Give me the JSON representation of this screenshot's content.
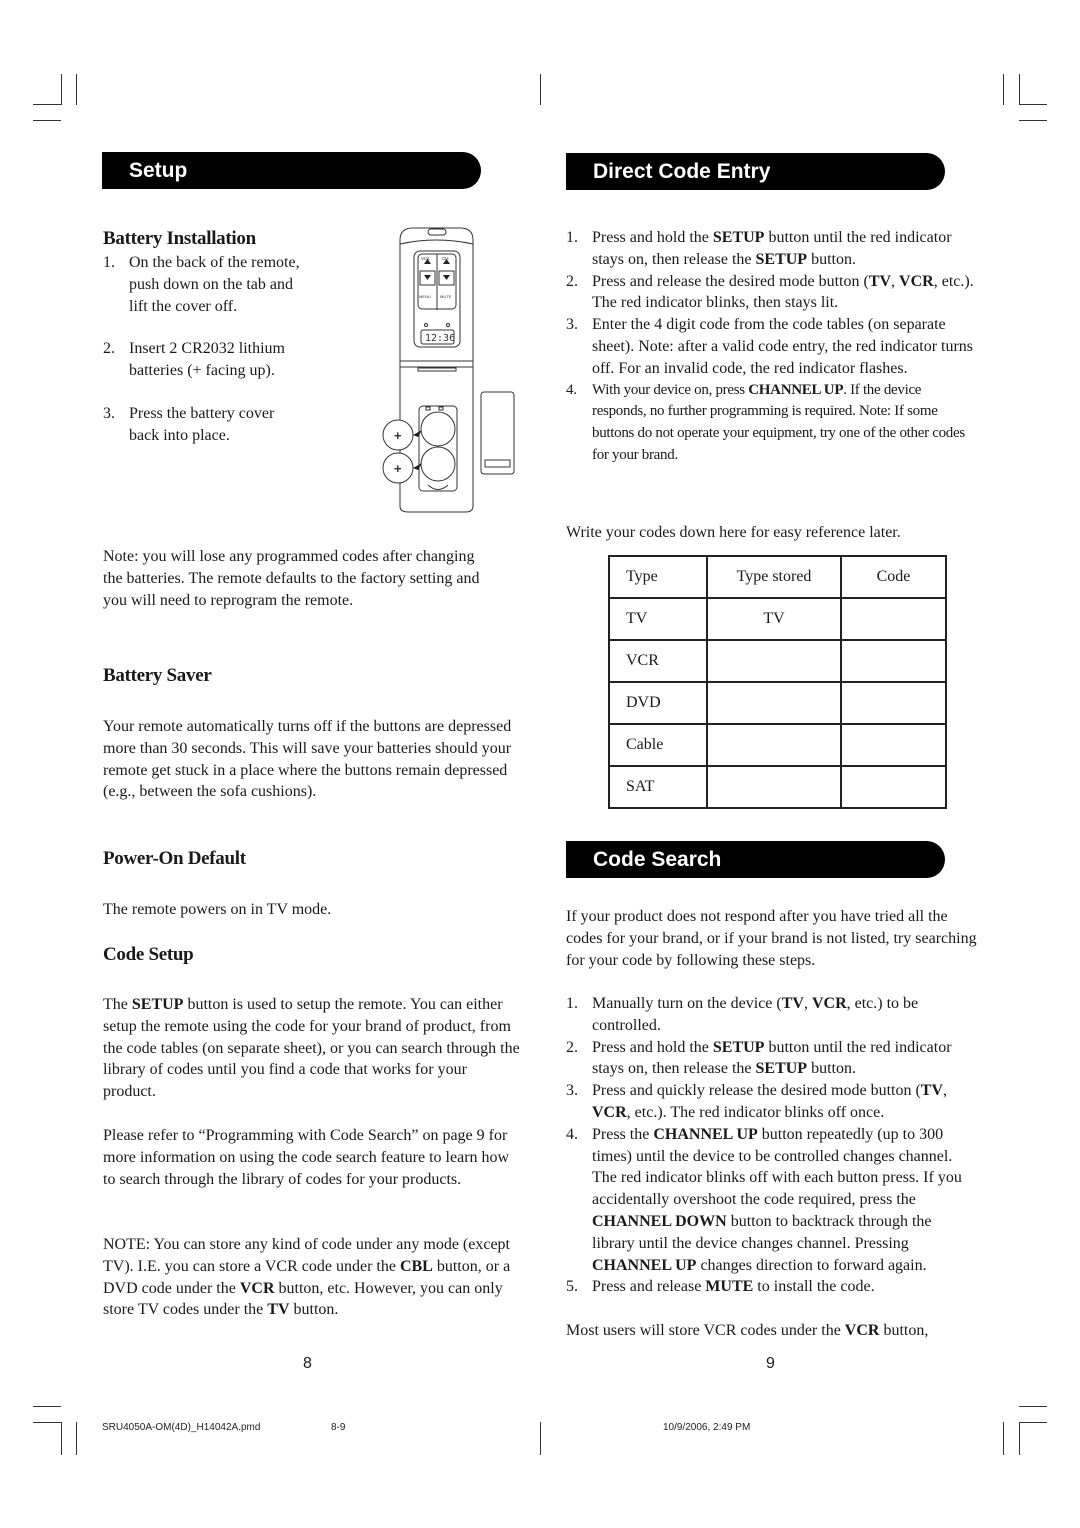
{
  "left_page": {
    "banner": "Setup",
    "battery_installation": {
      "heading": "Battery Installation",
      "steps": [
        {
          "num": "1.",
          "lines": [
            "On the back of the remote,",
            "push down on the tab and",
            "lift the cover off."
          ]
        },
        {
          "num": "2.",
          "lines": [
            "Insert 2 CR2032 lithium",
            "batteries (+ facing up)."
          ]
        },
        {
          "num": "3.",
          "lines": [
            "Press the battery cover",
            "back into place."
          ]
        }
      ],
      "illustration": {
        "remote_buttons": [
          "VOL",
          "CH",
          "MENU",
          "MUTE"
        ],
        "display": "12:36",
        "battery_sign": "+"
      },
      "note": "Note: you will lose any programmed codes after changing the batteries. The remote defaults to the factory setting and you will need to reprogram the remote."
    },
    "battery_saver": {
      "heading": "Battery Saver",
      "body": "Your remote automatically turns off if the buttons are depressed more than 30 seconds. This will save your batteries should your remote get stuck in a place where the buttons remain depressed (e.g., between the sofa cushions)."
    },
    "power_on_default": {
      "heading": "Power-On Default",
      "body": "The remote powers on in TV mode."
    },
    "code_setup": {
      "heading": "Code Setup",
      "p1_pre": "The ",
      "p1_bold": "SETUP",
      "p1_post": " button is used to setup the remote. You can either setup the remote using the code for your brand of product, from the code tables (on separate sheet), or you can search through the library of codes until you find a code that works for your product.",
      "p2": "Please refer to “Programming with Code Search” on page 9 for more information on using the code search feature to learn how to search through the library of codes for your  products.",
      "note_a": "NOTE: You can store any kind of code under any mode (except TV). I.E. you can store a VCR code under the ",
      "note_b": "CBL",
      "note_c": " button, or a DVD code under the ",
      "note_d": "VCR",
      "note_e": " button, etc. However, you can only store TV codes under the ",
      "note_f": "TV",
      "note_g": " button."
    },
    "page_number": "8"
  },
  "right_page": {
    "direct_code_entry": {
      "banner": "Direct Code Entry",
      "step1": {
        "num": "1.",
        "a": "Press and hold the ",
        "b": "SETUP",
        "c": " button until the red indicator stays on, then release the ",
        "d": "SETUP",
        "e": " button."
      },
      "step2": {
        "num": "2.",
        "a": "Press and release the desired mode button (",
        "b": "TV",
        "c": ", ",
        "d": "VCR",
        "e": ", etc.). The red indicator blinks, then stays lit."
      },
      "step3": {
        "num": "3.",
        "a": "Enter the 4 digit code from the code tables (on separate sheet). Note: after a valid code entry, the red indicator turns off.  For an invalid code, the red indicator flashes."
      },
      "step4": {
        "num": "4.",
        "a": "With your device on, press ",
        "b": "CHANNEL UP",
        "c": ". If the device responds, no further programming is required. Note: If some buttons do not operate your equipment, try one of the other codes for your brand."
      },
      "write_codes": "Write your codes down here for easy reference later."
    },
    "code_table": {
      "headers": [
        "Type",
        "Type  stored",
        "Code"
      ],
      "rows": [
        [
          "TV",
          "TV",
          ""
        ],
        [
          "VCR",
          "",
          ""
        ],
        [
          "DVD",
          "",
          ""
        ],
        [
          "Cable",
          "",
          ""
        ],
        [
          "SAT",
          "",
          ""
        ]
      ]
    },
    "code_search": {
      "banner": "Code Search",
      "intro": "If your product does not respond after you have tried all the codes for your brand, or if your brand is not listed, try searching for your code by following these steps.",
      "step1": {
        "num": "1.",
        "a": "Manually turn on the device (",
        "b": "TV",
        "c": ", ",
        "d": "VCR",
        "e": ", etc.) to be controlled."
      },
      "step2": {
        "num": "2.",
        "a": "Press and hold the ",
        "b": "SETUP",
        "c": " button until the red indicator stays on, then release the ",
        "d": "SETUP",
        "e": " button."
      },
      "step3": {
        "num": "3.",
        "a": "Press and quickly release the desired mode button (",
        "b": "TV",
        "c": ", ",
        "d": "VCR",
        "e": ", etc.). The red indicator blinks off once."
      },
      "step4": {
        "num": "4.",
        "a": "Press the ",
        "b": "CHANNEL UP",
        "c": " button repeatedly (up to 300 times) until the device to be controlled changes channel. The red indicator blinks off with each button press.  If you accidentally overshoot the code required, press the ",
        "d": "CHANNEL DOWN",
        "e": " button to backtrack through the library until the device changes channel. Pressing ",
        "f": "CHANNEL UP",
        "g": " changes direction to forward again."
      },
      "step5": {
        "num": "5.",
        "a": "Press and release ",
        "b": "MUTE",
        "c": " to install the code."
      },
      "trailing_a": "Most users will store VCR codes under the ",
      "trailing_b": "VCR",
      "trailing_c": " button,"
    },
    "page_number": "9"
  },
  "footer": {
    "filename": "SRU4050A-OM(4D)_H14042A.pmd",
    "pages": "8-9",
    "timestamp": "10/9/2006, 2:49 PM"
  }
}
